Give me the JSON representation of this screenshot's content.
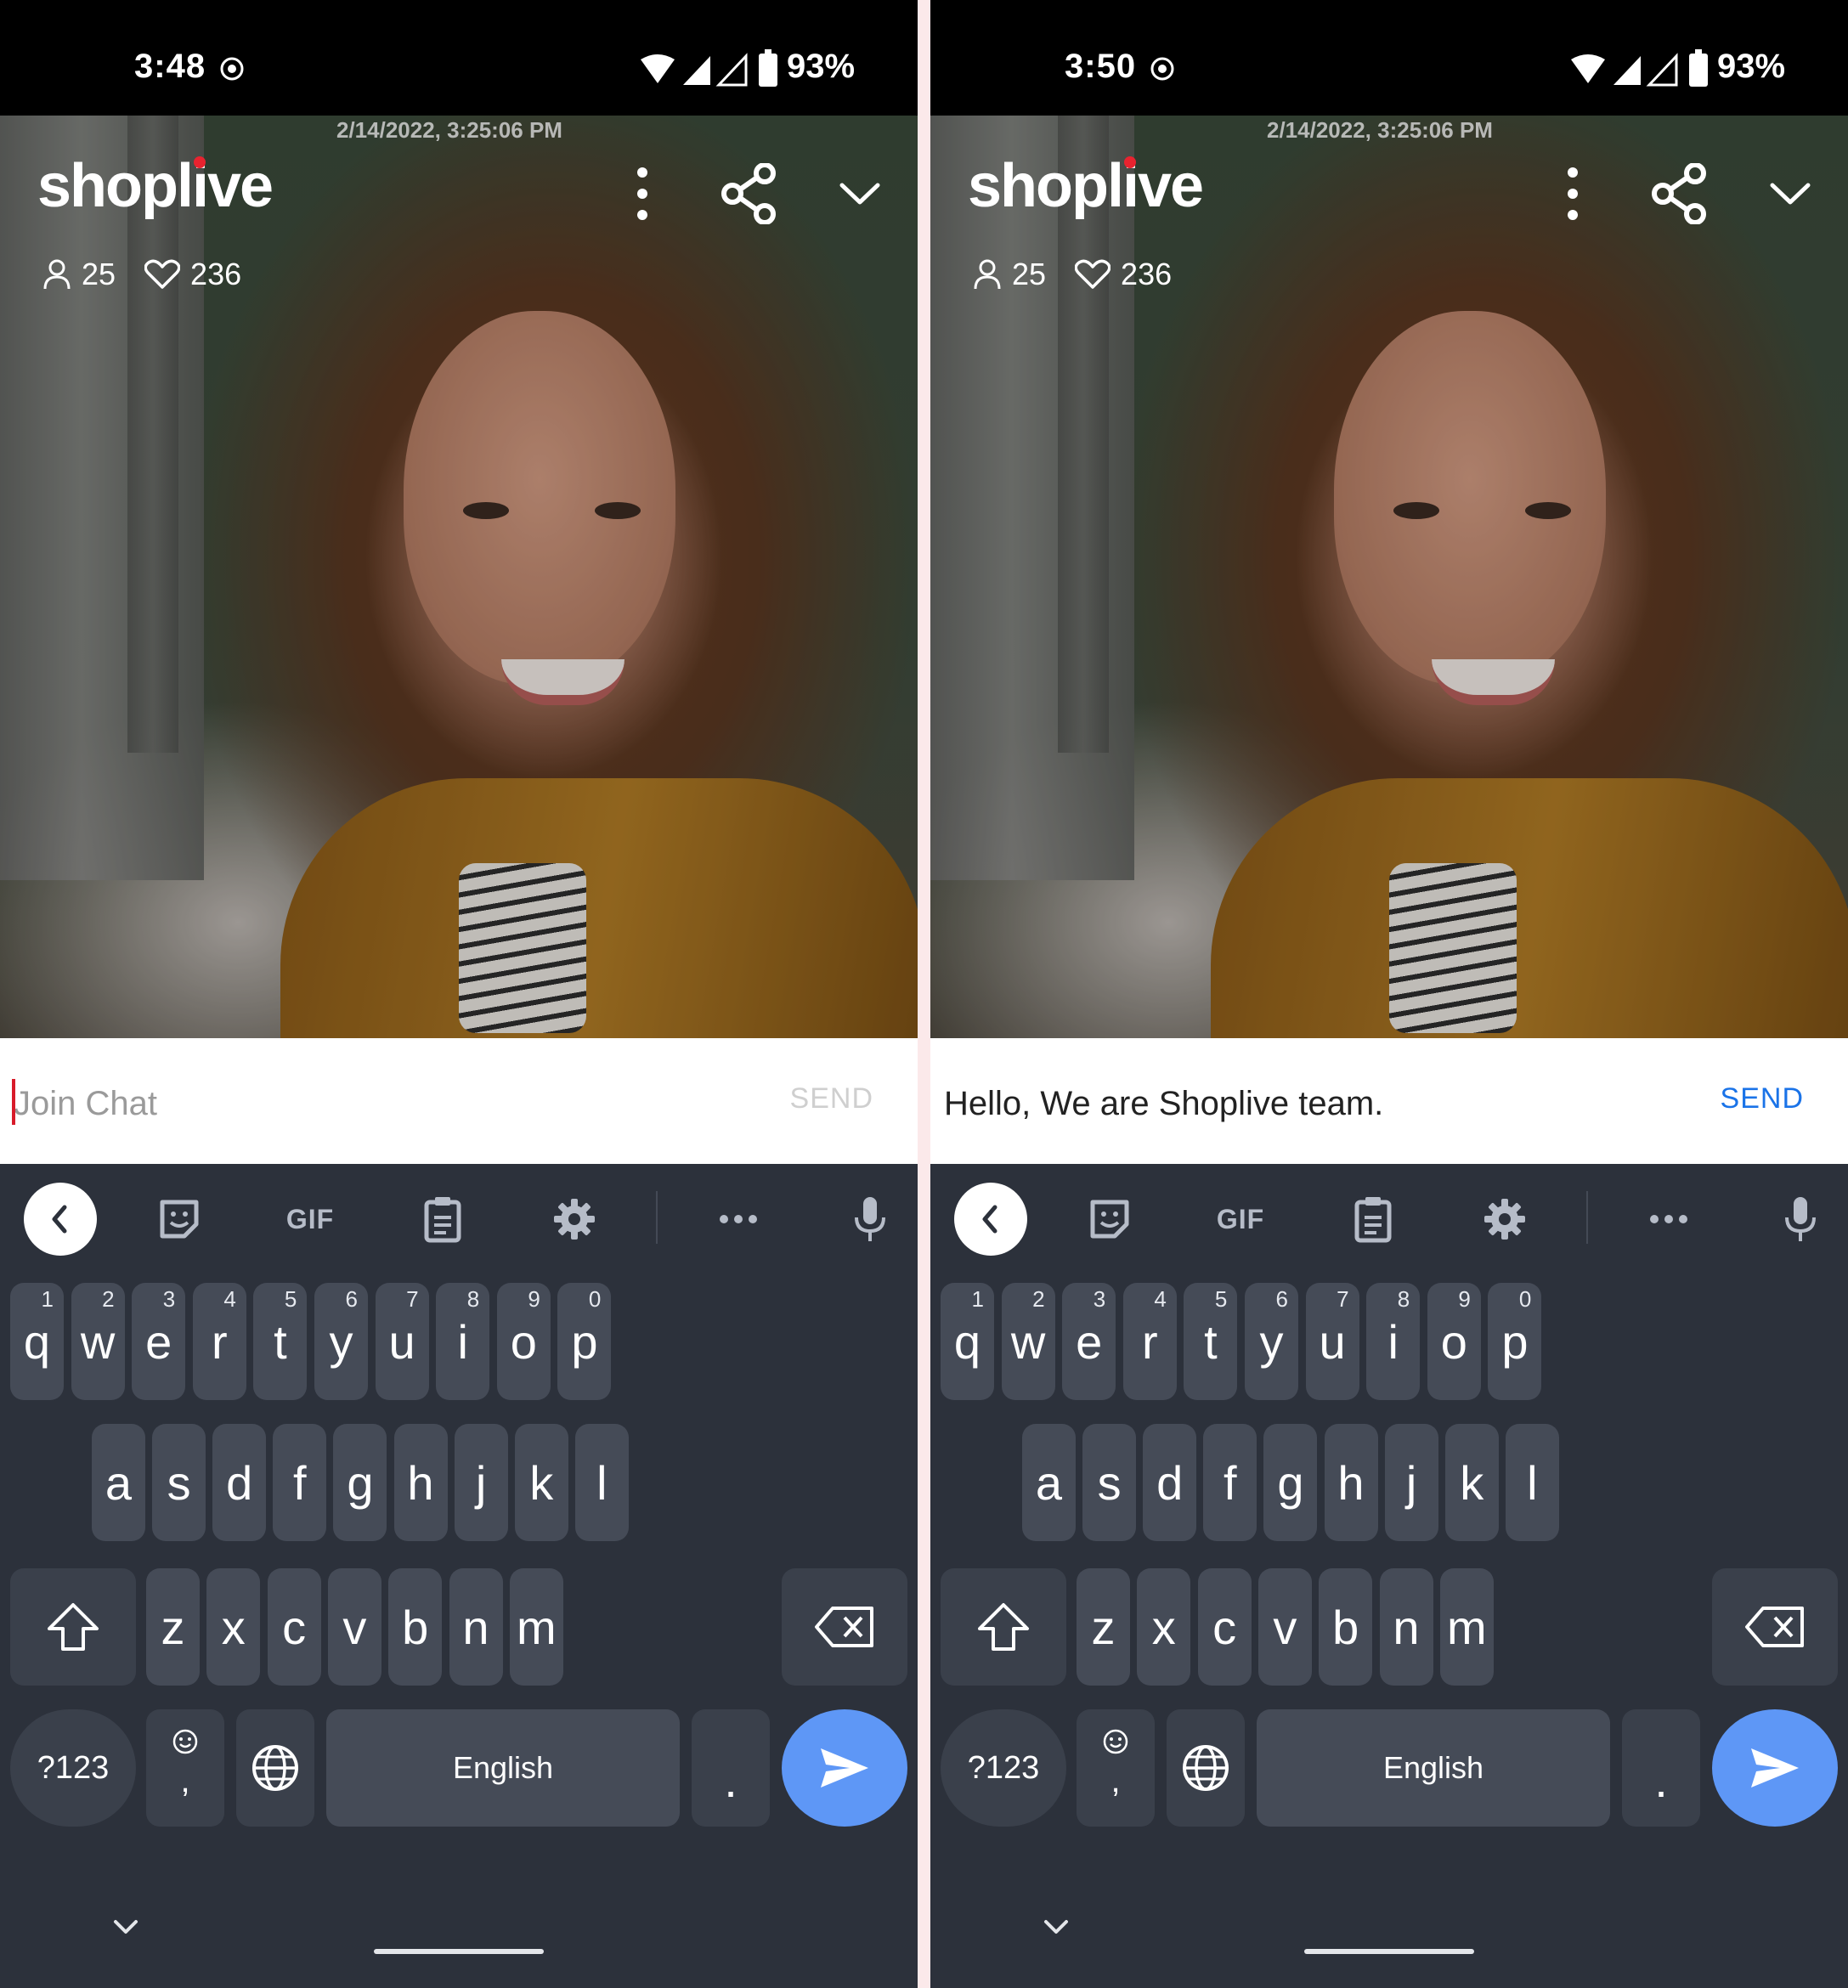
{
  "panels": [
    {
      "status_bar": {
        "time": "3:48",
        "battery": "93%"
      },
      "video": {
        "timestamp": "2/14/2022, 3:25:06 PM",
        "logo": {
          "pre": "shopl",
          "i": "i",
          "post": "ve"
        },
        "viewers": "25",
        "likes": "236"
      },
      "chat": {
        "placeholder": "Join Chat",
        "value": "",
        "send": "SEND",
        "send_state": "disabled"
      },
      "keyboard": {
        "toolbar": {
          "gif": "GIF"
        },
        "row1": [
          {
            "k": "q",
            "h": "1"
          },
          {
            "k": "w",
            "h": "2"
          },
          {
            "k": "e",
            "h": "3"
          },
          {
            "k": "r",
            "h": "4"
          },
          {
            "k": "t",
            "h": "5"
          },
          {
            "k": "y",
            "h": "6"
          },
          {
            "k": "u",
            "h": "7"
          },
          {
            "k": "i",
            "h": "8"
          },
          {
            "k": "o",
            "h": "9"
          },
          {
            "k": "p",
            "h": "0"
          }
        ],
        "row2": [
          "a",
          "s",
          "d",
          "f",
          "g",
          "h",
          "j",
          "k",
          "l"
        ],
        "row3": [
          "z",
          "x",
          "c",
          "v",
          "b",
          "n",
          "m"
        ],
        "symbols": "?123",
        "emoji_comma": ",",
        "space": "English",
        "period": "."
      }
    },
    {
      "status_bar": {
        "time": "3:50",
        "battery": "93%"
      },
      "video": {
        "timestamp": "2/14/2022, 3:25:06 PM",
        "logo": {
          "pre": "shopl",
          "i": "i",
          "post": "ve"
        },
        "viewers": "25",
        "likes": "236"
      },
      "chat": {
        "placeholder": "",
        "value": "Hello, We are Shoplive team.",
        "send": "SEND",
        "send_state": "active"
      },
      "keyboard": {
        "toolbar": {
          "gif": "GIF"
        },
        "row1": [
          {
            "k": "q",
            "h": "1"
          },
          {
            "k": "w",
            "h": "2"
          },
          {
            "k": "e",
            "h": "3"
          },
          {
            "k": "r",
            "h": "4"
          },
          {
            "k": "t",
            "h": "5"
          },
          {
            "k": "y",
            "h": "6"
          },
          {
            "k": "u",
            "h": "7"
          },
          {
            "k": "i",
            "h": "8"
          },
          {
            "k": "o",
            "h": "9"
          },
          {
            "k": "p",
            "h": "0"
          }
        ],
        "row2": [
          "a",
          "s",
          "d",
          "f",
          "g",
          "h",
          "j",
          "k",
          "l"
        ],
        "row3": [
          "z",
          "x",
          "c",
          "v",
          "b",
          "n",
          "m"
        ],
        "symbols": "?123",
        "emoji_comma": ",",
        "space": "English",
        "period": "."
      }
    }
  ],
  "colors": {
    "brand_dot": "#e8232f",
    "send_active": "#1a73e8",
    "send_disabled": "#cfcfcf",
    "enter_key": "#5e97f6",
    "keyboard_bg": "#2c313b",
    "key_bg": "#454b57"
  }
}
